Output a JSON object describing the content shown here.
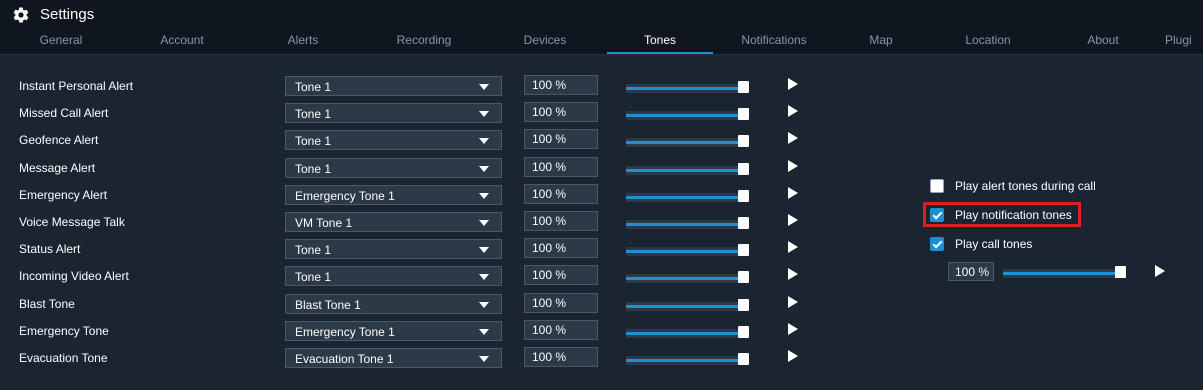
{
  "window": {
    "title": "Settings"
  },
  "tabs": [
    {
      "label": "General"
    },
    {
      "label": "Account"
    },
    {
      "label": "Alerts"
    },
    {
      "label": "Recording"
    },
    {
      "label": "Devices"
    },
    {
      "label": "Tones",
      "active": true
    },
    {
      "label": "Notifications"
    },
    {
      "label": "Map"
    },
    {
      "label": "Location"
    },
    {
      "label": "About"
    },
    {
      "label": "Plugi"
    }
  ],
  "tone_rows": [
    {
      "label": "Instant Personal Alert",
      "tone": "Tone 1",
      "volume": "100 %",
      "level": 1.0
    },
    {
      "label": "Missed Call Alert",
      "tone": "Tone 1",
      "volume": "100 %",
      "level": 1.0
    },
    {
      "label": "Geofence Alert",
      "tone": "Tone 1",
      "volume": "100 %",
      "level": 1.0
    },
    {
      "label": "Message Alert",
      "tone": "Tone 1",
      "volume": "100 %",
      "level": 1.0
    },
    {
      "label": "Emergency Alert",
      "tone": "Emergency Tone 1",
      "volume": "100 %",
      "level": 1.0
    },
    {
      "label": "Voice Message Talk",
      "tone": "VM Tone 1",
      "volume": "100 %",
      "level": 1.0
    },
    {
      "label": "Status Alert",
      "tone": "Tone 1",
      "volume": "100 %",
      "level": 1.0
    },
    {
      "label": "Incoming Video Alert",
      "tone": "Tone 1",
      "volume": "100 %",
      "level": 1.0
    },
    {
      "label": "Blast Tone",
      "tone": "Blast Tone 1",
      "volume": "100 %",
      "level": 1.0
    },
    {
      "label": "Emergency Tone",
      "tone": "Emergency Tone 1",
      "volume": "100 %",
      "level": 1.0
    },
    {
      "label": "Evacuation Tone",
      "tone": "Evacuation Tone 1",
      "volume": "100 %",
      "level": 1.0
    }
  ],
  "options": {
    "play_alert_during_call": {
      "label": "Play alert tones during call",
      "checked": false
    },
    "play_notification": {
      "label": "Play notification tones",
      "checked": true
    },
    "play_call": {
      "label": "Play call tones",
      "checked": true
    },
    "call_volume": {
      "value": "100 %",
      "level": 1.0
    }
  },
  "colors": {
    "accent": "#1d8fd3",
    "background": "#1b2532",
    "highlight": "#e02020"
  },
  "icons": {
    "settings": "gear-icon",
    "play": "play-icon",
    "dropdown": "chevron-down-icon"
  }
}
